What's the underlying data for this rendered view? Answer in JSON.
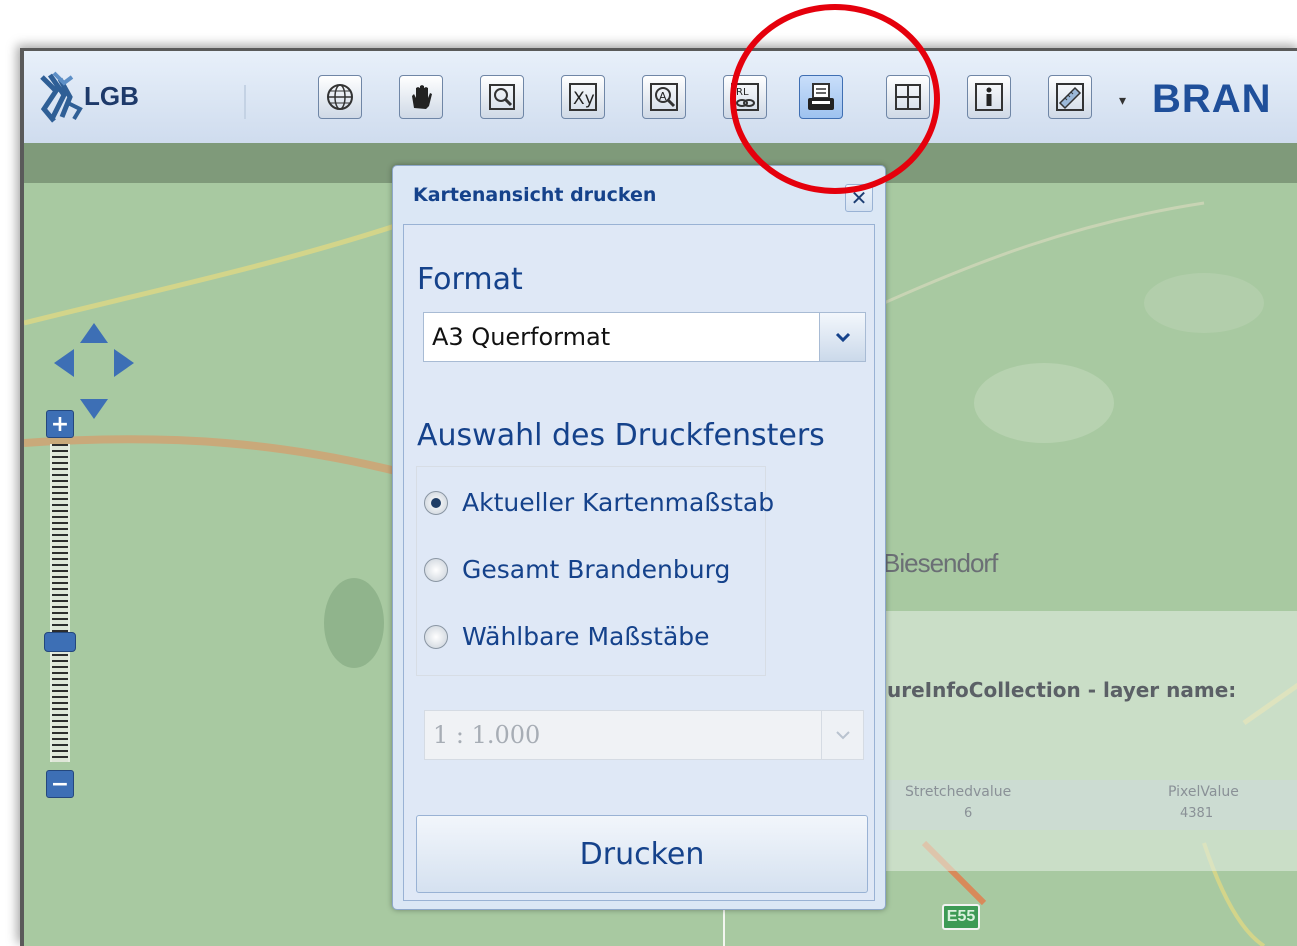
{
  "app": {
    "logo_text": "LGB",
    "brand_text": "BRAN"
  },
  "toolbar": {
    "tools": [
      {
        "icon": "globe-icon"
      },
      {
        "icon": "hand-pan-icon"
      },
      {
        "icon": "zoom-extent-icon"
      },
      {
        "icon": "xy-coordinate-icon",
        "label": "Xy"
      },
      {
        "icon": "address-search-icon",
        "label": "A"
      },
      {
        "icon": "url-link-icon",
        "label": "URL"
      },
      {
        "icon": "print-icon",
        "active": true
      },
      {
        "icon": "grid-icon"
      },
      {
        "icon": "info-icon",
        "label": "i"
      },
      {
        "icon": "measure-ruler-icon"
      }
    ]
  },
  "map": {
    "place_label": "Biesendorf",
    "info_title": "ureInfoCollection - layer name:",
    "table": {
      "columns": [
        "Stretchedvalue",
        "PixelValue"
      ],
      "values": [
        "6",
        "4381"
      ]
    },
    "road_badge": "E55"
  },
  "dialog": {
    "title": "Kartenansicht drucken",
    "close_symbol": "✕",
    "format_label": "Format",
    "format_value": "A3 Querformat",
    "selection_label": "Auswahl des Druckfensters",
    "options": [
      {
        "label": "Aktueller Kartenmaßstab",
        "checked": true
      },
      {
        "label": "Gesamt Brandenburg",
        "checked": false
      },
      {
        "label": "Wählbare Maßstäbe",
        "checked": false
      }
    ],
    "scale_value": "1 : 1.000",
    "print_button": "Drucken"
  },
  "colors": {
    "accent": "#15428b",
    "highlight": "#e5000c",
    "map_green": "#a9c9a2"
  }
}
